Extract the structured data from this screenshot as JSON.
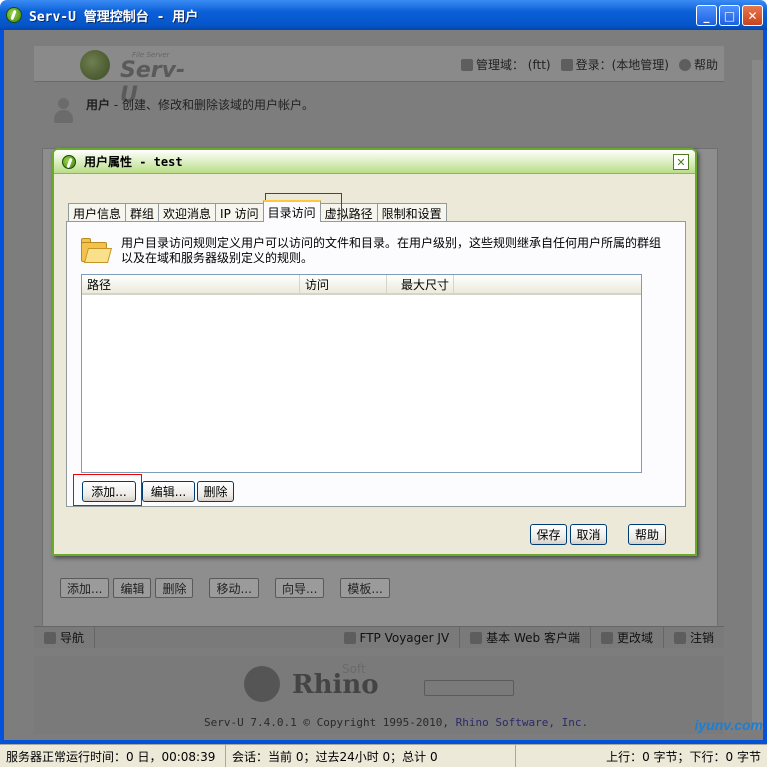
{
  "window": {
    "title": "Serv-U 管理控制台 - 用户",
    "minimize": "_",
    "maximize": "□",
    "close": "✕"
  },
  "header": {
    "logo_text": "Serv-U",
    "logo_subtext": "File Server",
    "domain_label": "管理域：",
    "domain_value": "(ftt)",
    "login_label": "登录：",
    "login_value": "(本地管理)",
    "help": "帮助"
  },
  "subheader": {
    "title": "用户",
    "description": " - 创建、修改和删除该域的用户帐户。"
  },
  "background_buttons": [
    "添加...",
    "编辑",
    "删除",
    "移动...",
    "向导...",
    "模板..."
  ],
  "navbar": {
    "nav": "导航",
    "ftp_voyager": "FTP Voyager JV",
    "web_client": "基本 Web 客户端",
    "change_domain": "更改域",
    "logout": "注销"
  },
  "footer": {
    "rhino_word": "Rhino",
    "rhino_soft": "Soft",
    "version": "Serv-U 7.4.0.1 © Copyright 1995-2010,",
    "company": "Rhino Software, Inc."
  },
  "dialog": {
    "title": "用户属性 - test",
    "close": "✕",
    "tabs": [
      {
        "label": "用户信息"
      },
      {
        "label": "群组"
      },
      {
        "label": "欢迎消息"
      },
      {
        "label": "IP 访问"
      },
      {
        "label": "目录访问"
      },
      {
        "label": "虚拟路径"
      },
      {
        "label": "限制和设置"
      }
    ],
    "description": "用户目录访问规则定义用户可以访问的文件和目录。在用户级别，这些规则继承自任何用户所属的群组以及在域和服务器级别定义的规则。",
    "columns": [
      "路径",
      "访问",
      "最大尺寸"
    ],
    "add_button": "添加...",
    "edit_button": "编辑...",
    "delete_button": "删除",
    "save_button": "保存",
    "cancel_button": "取消",
    "help_button": "帮助"
  },
  "statusbar": {
    "uptime": "服务器正常运行时间：0 日，00:08:39",
    "sessions": "会话：当前 0；过去24小时 0；总计 0",
    "traffic": "上行：0 字节；下行：0 字节"
  },
  "watermark": "iyunv.com"
}
